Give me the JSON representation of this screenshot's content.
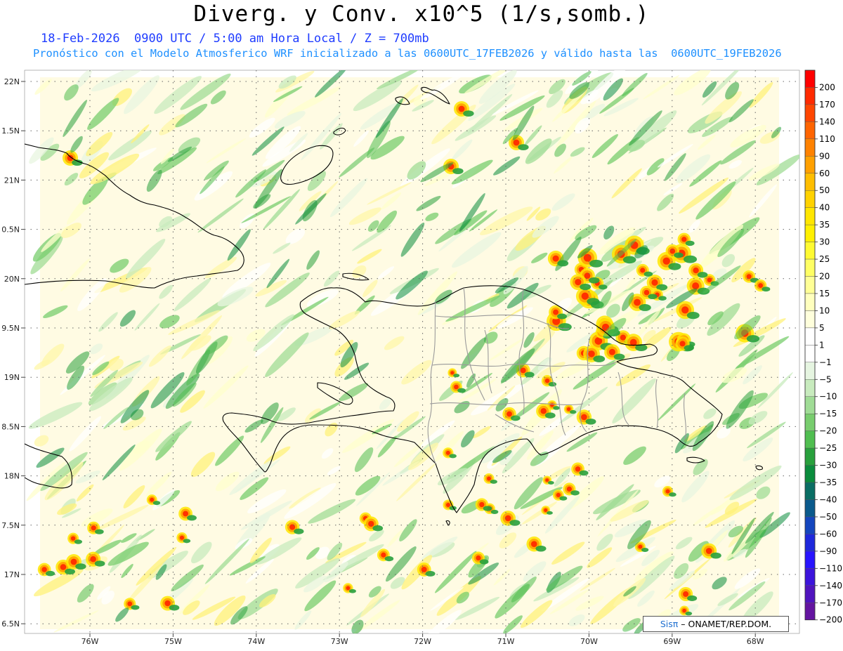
{
  "header": {
    "title": "Diverg. y Conv. x10^5 (1/s,somb.)",
    "line1": "18-Feb-2026  0900 UTC / 5:00 am Hora Local / Z = 700mb",
    "line2": "Pronóstico con el Modelo Atmosferico WRF inicializado a las 0600UTC_17FEB2026 y válido hasta las  0600UTC_19FEB2026"
  },
  "axes": {
    "lat_labels": [
      "22N",
      "1.5N",
      "21N",
      "0.5N",
      "20N",
      "9.5N",
      "19N",
      "8.5N",
      "18N",
      "7.5N",
      "17N",
      "6.5N"
    ],
    "lon_labels": [
      "76W",
      "75W",
      "74W",
      "73W",
      "72W",
      "71W",
      "70W",
      "69W",
      "68W"
    ]
  },
  "colorbar": {
    "labels": [
      "200",
      "170",
      "140",
      "110",
      "90",
      "60",
      "50",
      "40",
      "35",
      "30",
      "25",
      "20",
      "15",
      "10",
      "5",
      "1",
      "−1",
      "−5",
      "−10",
      "−15",
      "−20",
      "−25",
      "−30",
      "−35",
      "−40",
      "−50",
      "−60",
      "−90",
      "−110",
      "−140",
      "−170",
      "−200"
    ],
    "colors": [
      "#ff0000",
      "#ff2a00",
      "#ff4600",
      "#ff6400",
      "#ff8200",
      "#ffa000",
      "#ffbe00",
      "#ffd200",
      "#ffe600",
      "#fff000",
      "#fffa32",
      "#ffff64",
      "#ffff96",
      "#ffffbe",
      "#ffffdc",
      "#ffffff",
      "#ffffff",
      "#e6f5e1",
      "#c8ebbe",
      "#a0dc96",
      "#78cd6e",
      "#50be50",
      "#28a03c",
      "#0a8c3c",
      "#0a6e64",
      "#0a5a8c",
      "#1446be",
      "#1e28dc",
      "#2814ff",
      "#3c14dc",
      "#5014be",
      "#6414a0"
    ]
  },
  "credit": {
    "sis": "Sisπ",
    "rest": "– ONAMET/REP.DOM."
  }
}
